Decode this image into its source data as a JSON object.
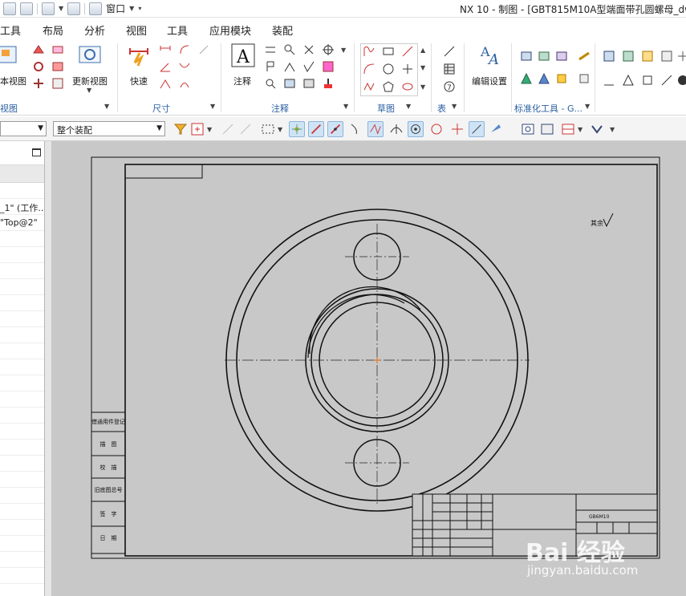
{
  "titlebar": {
    "window_menu": "窗口",
    "title": "NX 10 - 制图 - [GBT815M10A型端面带孔圆螺母_dw"
  },
  "menu": {
    "tabs": [
      "工具",
      "布局",
      "分析",
      "视图",
      "工具",
      "应用模块",
      "装配"
    ]
  },
  "ribbon": {
    "groups": {
      "view": {
        "label": "视图",
        "base_view": "本视图",
        "update_views": "更新视图"
      },
      "dimension": {
        "label": "尺寸",
        "rapid": "快速"
      },
      "annotation": {
        "label": "注释",
        "note": "注释"
      },
      "sketch": {
        "label": "草图"
      },
      "table": {
        "label": "表"
      },
      "settings": {
        "edit_settings": "编辑设置"
      },
      "std_tools": {
        "label": "标准化工具 - G..."
      }
    }
  },
  "toolbar": {
    "filter_value": "",
    "scope_value": "整个装配"
  },
  "navigator": {
    "rows": [
      "_1\" (工作...",
      "\"Top@2\""
    ]
  },
  "drawing": {
    "surface_note": "其余",
    "left_block": [
      "借通用件登记",
      "描　图",
      "校　描",
      "旧底图总号",
      "签　字",
      "日　期"
    ],
    "title_block": {
      "name": "GB6M10",
      "company": ""
    }
  },
  "watermark": {
    "brand": "Bai 经验",
    "url": "jingyan.baidu.com"
  },
  "colors": {
    "group_label": "#2b5fa3",
    "canvas_bg": "#c8c8c8",
    "center_mark": "#e07a30"
  }
}
